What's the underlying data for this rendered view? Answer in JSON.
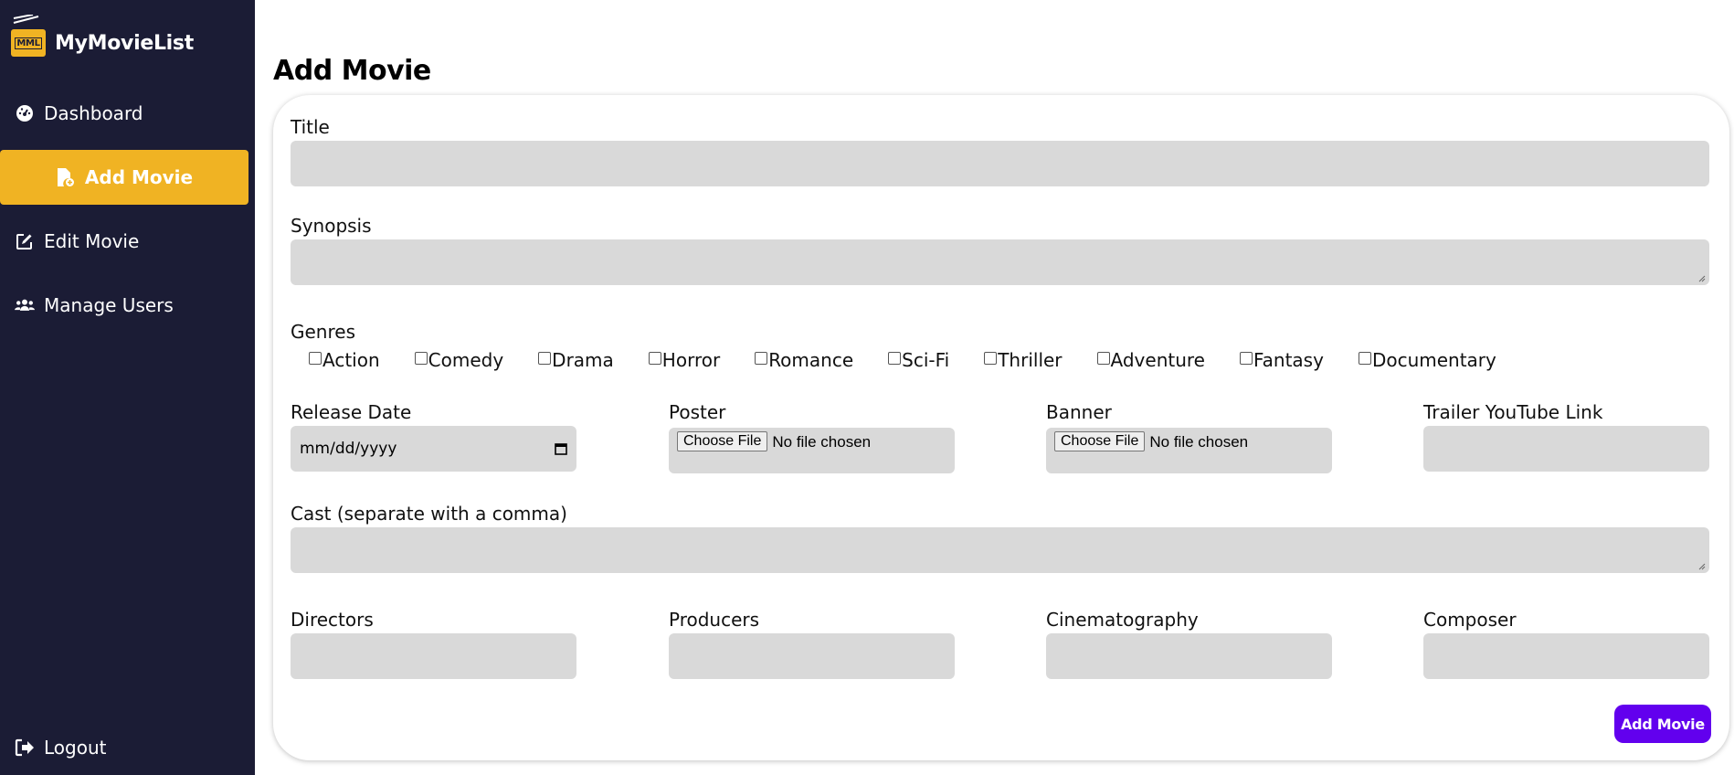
{
  "brand": {
    "name": "MyMovieList",
    "logo_text": "MML"
  },
  "colors": {
    "sidebar_bg": "#1b1c35",
    "accent": "#f0b323",
    "submit": "#6200ee",
    "field_bg": "#d9d9d9"
  },
  "sidebar": {
    "items": [
      {
        "label": "Dashboard",
        "icon": "gauge-icon"
      },
      {
        "label": "Add Movie",
        "icon": "file-add-icon",
        "active": true
      },
      {
        "label": "Edit Movie",
        "icon": "edit-icon"
      },
      {
        "label": "Manage Users",
        "icon": "users-icon"
      }
    ],
    "logout": {
      "label": "Logout",
      "icon": "logout-icon"
    }
  },
  "page": {
    "title": "Add Movie"
  },
  "form": {
    "title_label": "Title",
    "synopsis_label": "Synopsis",
    "genres_label": "Genres",
    "genres": [
      "Action",
      "Comedy",
      "Drama",
      "Horror",
      "Romance",
      "Sci-Fi",
      "Thriller",
      "Adventure",
      "Fantasy",
      "Documentary"
    ],
    "release_date_label": "Release Date",
    "release_date_placeholder": "mm/dd/yyyy",
    "poster_label": "Poster",
    "banner_label": "Banner",
    "choose_file": "Choose File",
    "no_file": "No file chosen",
    "trailer_label": "Trailer YouTube Link",
    "cast_label": "Cast (separate with a comma)",
    "directors_label": "Directors",
    "producers_label": "Producers",
    "cinematography_label": "Cinematography",
    "composer_label": "Composer",
    "submit_label": "Add Movie"
  }
}
